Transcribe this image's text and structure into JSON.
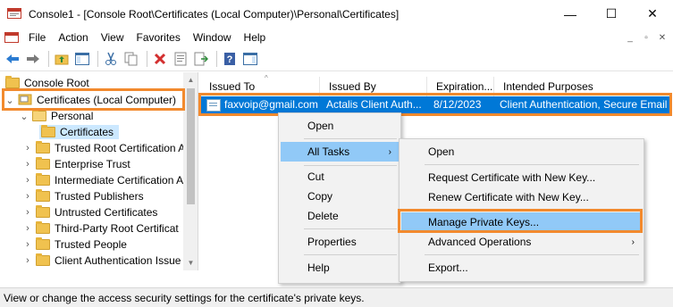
{
  "window": {
    "title": "Console1 - [Console Root\\Certificates (Local Computer)\\Personal\\Certificates]",
    "minimize": "—",
    "maximize": "☐",
    "close": "✕"
  },
  "menu": {
    "items": [
      "File",
      "Action",
      "View",
      "Favorites",
      "Window",
      "Help"
    ],
    "mdi": [
      "_",
      "▫",
      "✕"
    ]
  },
  "toolbar": {
    "icons": [
      "back-icon",
      "forward-icon",
      "up-folder-icon",
      "show-hide-tree-icon",
      "cut-icon",
      "copy-icon",
      "delete-icon",
      "properties-icon",
      "export-list-icon",
      "help-icon",
      "show-hide-action-pane-icon"
    ]
  },
  "tree": {
    "root": "Console Root",
    "certificates_local": "Certificates (Local Computer)",
    "personal": "Personal",
    "certificates": "Certificates",
    "items": [
      "Trusted Root Certification A",
      "Enterprise Trust",
      "Intermediate Certification A",
      "Trusted Publishers",
      "Untrusted Certificates",
      "Third-Party Root Certificat",
      "Trusted People",
      "Client Authentication Issue"
    ]
  },
  "list": {
    "columns": [
      "Issued To",
      "Issued By",
      "Expiration...",
      "Intended Purposes"
    ],
    "rows": [
      {
        "issued_to": "faxvoip@gmail.com",
        "issued_by": "Actalis Client Auth...",
        "expiration": "8/12/2023",
        "purposes": "Client Authentication, Secure Email"
      }
    ]
  },
  "context_menu": {
    "open": "Open",
    "all_tasks": "All Tasks",
    "cut": "Cut",
    "copy": "Copy",
    "delete": "Delete",
    "properties": "Properties",
    "help": "Help",
    "submenu_arrow": "›"
  },
  "submenu": {
    "open": "Open",
    "request_new_key": "Request Certificate with New Key...",
    "renew_new_key": "Renew Certificate with New Key...",
    "manage_private_keys": "Manage Private Keys...",
    "advanced_operations": "Advanced Operations",
    "export": "Export..."
  },
  "status": {
    "text": "View or change the access security settings for the certificate's private keys."
  },
  "colors": {
    "selection": "#0078d7",
    "highlight_orange": "#f28a2e",
    "menu_hover": "#91c9f7"
  }
}
